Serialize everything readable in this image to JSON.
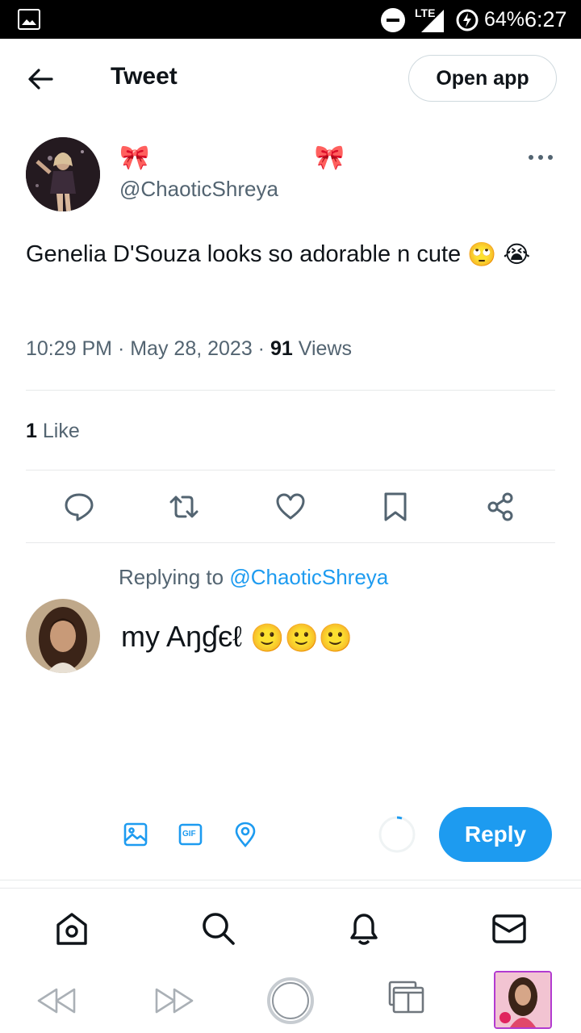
{
  "status_bar": {
    "network": "LTE",
    "battery": "64%",
    "time": "6:27"
  },
  "header": {
    "title": "Tweet",
    "open_app_label": "Open app"
  },
  "tweet": {
    "author_handle": "@ChaoticShreya",
    "display_name_emoji": "🎀 🎀",
    "text": "Genelia D'Souza looks so adorable n cute",
    "text_emoji": [
      "🙄",
      "😭"
    ],
    "time": "10:29 PM",
    "date": "May 28, 2023",
    "views_count": "91",
    "views_label": "Views",
    "likes_count": "1",
    "likes_label": "Like"
  },
  "actions": [
    "reply-icon",
    "retweet-icon",
    "like-icon",
    "bookmark-icon",
    "share-icon"
  ],
  "reply": {
    "replying_to_label": "Replying to",
    "replying_to_handle": "@ChaoticShreya",
    "text": "my Aŋɠєℓ",
    "emoji": [
      "🙂",
      "🙂",
      "🙂"
    ]
  },
  "composer": {
    "icons": [
      "image-icon",
      "gif-icon",
      "location-icon"
    ],
    "gif_label": "GIF",
    "reply_button_label": "Reply"
  },
  "bottom_nav": [
    "home-icon",
    "search-icon",
    "notifications-icon",
    "messages-icon"
  ],
  "colors": {
    "accent": "#1d9bf0",
    "text_primary": "#0f1419",
    "text_secondary": "#536471",
    "border": "#e7e9ea"
  }
}
